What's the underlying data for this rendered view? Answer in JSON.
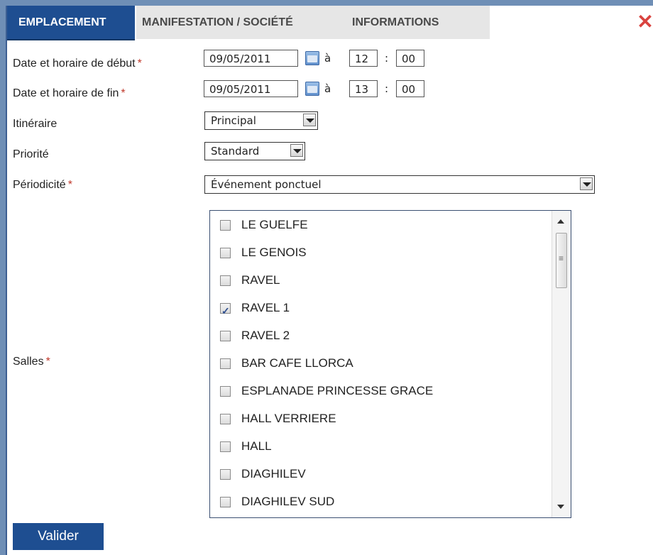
{
  "tabs": {
    "emplacement": "EMPLACEMENT",
    "manifestation": "MANIFESTATION / SOCIÉTÉ",
    "informations": "INFORMATIONS"
  },
  "close_icon": "close-icon",
  "form": {
    "start_label": "Date et horaire de début",
    "start_date": "09/05/2011",
    "start_a": "à",
    "start_hour": "12",
    "start_sep": ":",
    "start_min": "00",
    "end_label": "Date et horaire de fin",
    "end_date": "09/05/2011",
    "end_a": "à",
    "end_hour": "13",
    "end_sep": ":",
    "end_min": "00",
    "itineraire_label": "Itinéraire",
    "itineraire_value": "Principal",
    "priorite_label": "Priorité",
    "priorite_value": "Standard",
    "periodicite_label": "Périodicité",
    "periodicite_value": "Événement ponctuel",
    "salles_label": "Salles",
    "required_marker": "*"
  },
  "salles": [
    {
      "label": "LE GUELFE",
      "checked": false
    },
    {
      "label": "LE GENOIS",
      "checked": false
    },
    {
      "label": "RAVEL",
      "checked": false
    },
    {
      "label": "RAVEL 1",
      "checked": true
    },
    {
      "label": "RAVEL 2",
      "checked": false
    },
    {
      "label": "BAR CAFE LLORCA",
      "checked": false
    },
    {
      "label": "ESPLANADE PRINCESSE GRACE",
      "checked": false
    },
    {
      "label": "HALL VERRIERE",
      "checked": false
    },
    {
      "label": "HALL",
      "checked": false
    },
    {
      "label": "DIAGHILEV",
      "checked": false
    },
    {
      "label": "DIAGHILEV SUD",
      "checked": false
    }
  ],
  "button": {
    "valider": "Valider"
  },
  "colors": {
    "accent": "#1e4e91",
    "required": "#c0392b",
    "close": "#d9433f"
  }
}
